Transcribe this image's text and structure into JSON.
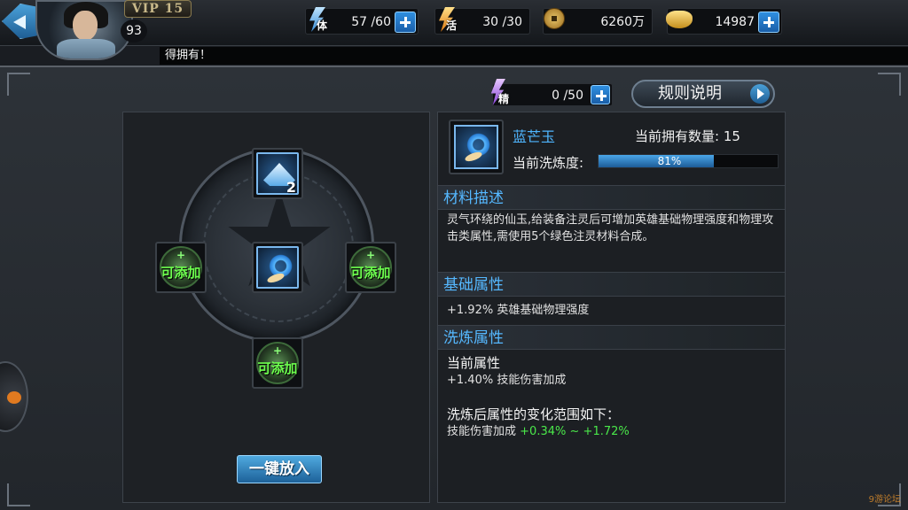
{
  "player": {
    "vip": "VIP 15",
    "level": "93"
  },
  "resources": {
    "stamina": {
      "icon_label": "体",
      "value": "57 /60"
    },
    "vigor": {
      "icon_label": "活",
      "value": "30 /30"
    },
    "coins": {
      "value": "6260万"
    },
    "ingots": {
      "value": "14987"
    },
    "essence": {
      "icon_label": "精",
      "value": "0 /50"
    }
  },
  "ticker": {
    "text": "得拥有！"
  },
  "rules_button": {
    "label": "规则说明"
  },
  "left": {
    "top_slot": {
      "count": "2"
    },
    "add_label": "可添加",
    "add_plus": "+",
    "one_key_button": "一键放入"
  },
  "item": {
    "name": "蓝芒玉",
    "own_count": "当前拥有数量: 15",
    "refine_label": "当前洗炼度:",
    "refine_percent": 81,
    "refine_text": "81%"
  },
  "sections": {
    "material": {
      "title": "材料描述",
      "text": "灵气环绕的仙玉,给装备注灵后可增加英雄基础物理强度和物理攻击类属性,需使用5个绿色注灵材料合成。"
    },
    "base": {
      "title": "基础属性",
      "text": "+1.92% 英雄基础物理强度"
    },
    "refine": {
      "title": "洗炼属性",
      "current_title": "当前属性",
      "current_text": "+1.40% 技能伤害加成",
      "range_title": "洗炼后属性的变化范围如下：",
      "range_prefix": "技能伤害加成",
      "range_low": "+0.34%",
      "range_sep": "~",
      "range_high": "+1.72%"
    }
  },
  "watermark": "9游论坛",
  "colors": {
    "accent_blue": "#4fb6ff",
    "green_text": "#4ae84a",
    "progress_fill": "#2a7fd6"
  },
  "icons": [
    "back-arrow-icon",
    "stamina-bolt-icon",
    "vigor-bolt-icon",
    "copper-coin-icon",
    "gold-ingot-icon",
    "essence-bolt-icon",
    "plus-icon",
    "jade-icon",
    "cone-icon"
  ]
}
